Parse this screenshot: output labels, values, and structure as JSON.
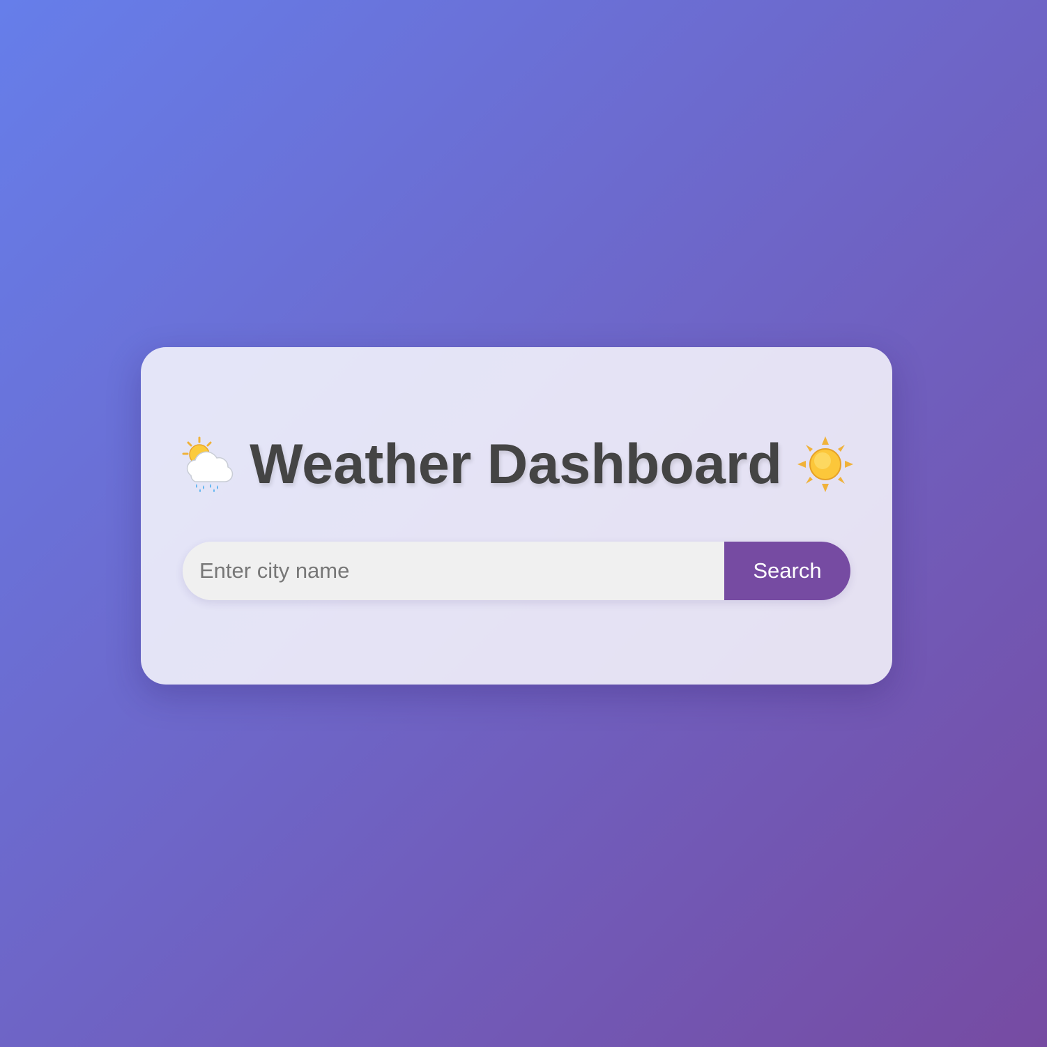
{
  "header": {
    "title": "Weather Dashboard",
    "left_icon": "sun-behind-rain-cloud-icon",
    "right_icon": "sun-icon"
  },
  "search": {
    "placeholder": "Enter city name",
    "value": "",
    "button_label": "Search"
  },
  "colors": {
    "background_start": "#667eea",
    "background_end": "#764ba2",
    "accent": "#764ba2",
    "title_text": "#444444"
  }
}
